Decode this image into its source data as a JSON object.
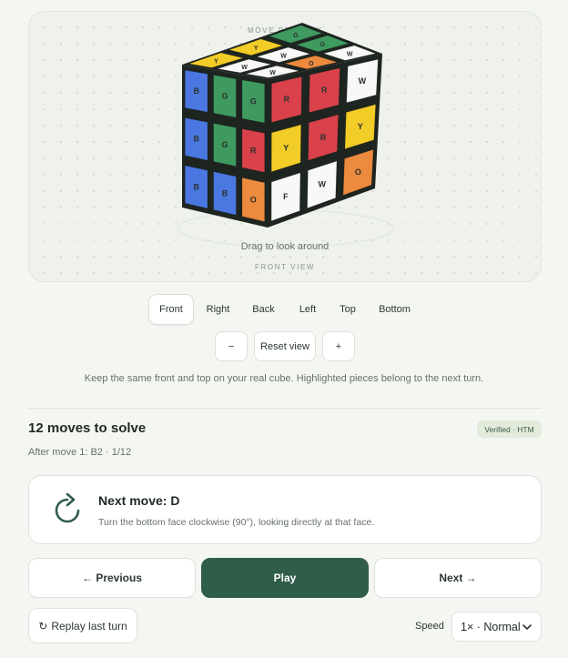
{
  "preview": {
    "top_label": "MOVE PREVIEW",
    "bottom_label": "FRONT VIEW",
    "drag_hint": "Drag to look around"
  },
  "cube": {
    "colors": {
      "B": "#4a78e0",
      "G": "#3f9a60",
      "R": "#d9424a",
      "Y": "#f2cc27",
      "O": "#ec8a3e",
      "W": "#f8f8f6"
    },
    "front": [
      [
        "B",
        "G",
        "G"
      ],
      [
        "B",
        "G",
        "R"
      ],
      [
        "B",
        "B",
        "O"
      ]
    ],
    "right": [
      [
        "R",
        "R",
        "W"
      ],
      [
        "Y",
        "R",
        "Y"
      ],
      [
        "F",
        "W",
        "O"
      ]
    ],
    "top": [
      [
        "Y",
        "Y",
        "G"
      ],
      [
        "W",
        "W",
        "G"
      ],
      [
        "W",
        "O",
        "W"
      ]
    ]
  },
  "views": {
    "items": [
      "Front",
      "Right",
      "Back",
      "Left",
      "Top",
      "Bottom"
    ],
    "active": "Front"
  },
  "zoom": {
    "minus": "−",
    "reset": "Reset view",
    "plus": "+"
  },
  "hint": "Keep the same front and top on your real cube. Highlighted pieces belong to the next turn.",
  "solve": {
    "title": "12 moves to solve",
    "badge": "Verified · HTM",
    "progress": "After move 1: B2 · 1/12"
  },
  "next_move": {
    "title": "Next move: D",
    "description": "Turn the bottom face clockwise (90°), looking directly at that face."
  },
  "nav": {
    "previous": "← Previous",
    "play": "Play",
    "next": "Next →"
  },
  "replay": {
    "icon": "↻",
    "label": "Replay last turn"
  },
  "speed": {
    "label": "Speed",
    "value": "1× · Normal"
  }
}
